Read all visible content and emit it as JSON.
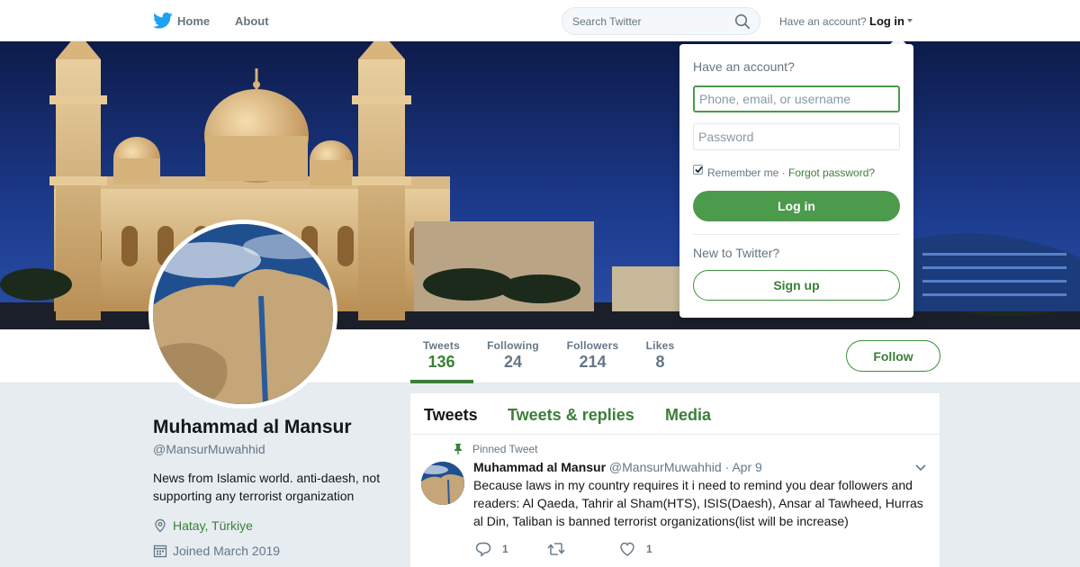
{
  "topnav": {
    "home_label": "Home",
    "about_label": "About",
    "search_placeholder": "Search Twitter",
    "have_account_label": "Have an account?",
    "login_label": "Log in"
  },
  "profile_nav": {
    "stats": [
      {
        "label": "Tweets",
        "value": "136"
      },
      {
        "label": "Following",
        "value": "24"
      },
      {
        "label": "Followers",
        "value": "214"
      },
      {
        "label": "Likes",
        "value": "8"
      }
    ],
    "follow_label": "Follow"
  },
  "profile": {
    "name": "Muhammad al Mansur",
    "handle": "@MansurMuwahhid",
    "bio": "News from Islamic world. anti-daesh, not supporting any terrorist organization",
    "location": "Hatay, Türkiye",
    "joined": "Joined March 2019"
  },
  "timeline": {
    "tabs": [
      "Tweets",
      "Tweets & replies",
      "Media"
    ],
    "pinned_label": "Pinned Tweet",
    "tweet": {
      "name": "Muhammad al Mansur",
      "handle": "@MansurMuwahhid",
      "separator": "·",
      "date": "Apr 9",
      "text": "Because laws in my country requires it i need to remind you dear followers and readers: Al Qaeda, Tahrir al Sham(HTS), ISIS(Daesh), Ansar al Tawheed, Hurras al Din, Taliban is banned terrorist organizations(list will be increase)",
      "reply_count": "1",
      "retweet_count": "",
      "like_count": "1"
    }
  },
  "login_dropdown": {
    "title": "Have an account?",
    "username_placeholder": "Phone, email, or username",
    "password_placeholder": "Password",
    "remember_label": "Remember me ·",
    "forgot_label": "Forgot password?",
    "login_button": "Log in",
    "new_label": "New to Twitter?",
    "signup_button": "Sign up"
  },
  "colors": {
    "accent": "#3b7f38",
    "accent_button": "#4c9a4c",
    "bird": "#1da1f2",
    "muted": "#657786"
  },
  "icons": [
    "twitter-bird-icon",
    "search-icon",
    "caret-down-icon",
    "location-icon",
    "calendar-icon",
    "pin-icon",
    "chevron-down-icon",
    "reply-icon",
    "retweet-icon",
    "like-icon",
    "checkmark-icon"
  ]
}
